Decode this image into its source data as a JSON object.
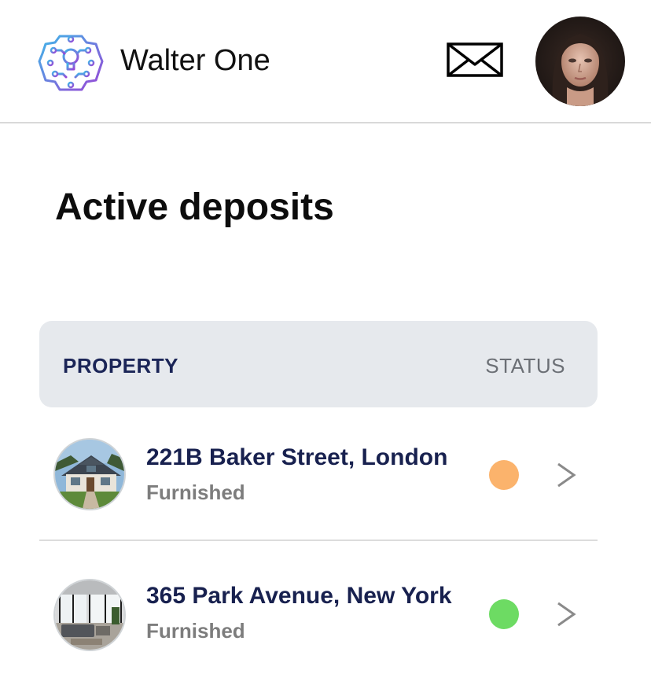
{
  "header": {
    "app_title": "Walter One",
    "logo_icon": "brain-circuit-icon",
    "mail_icon": "envelope-icon",
    "avatar_icon": "user-avatar"
  },
  "main": {
    "page_title": "Active deposits",
    "table": {
      "columns": [
        "PROPERTY",
        "STATUS"
      ],
      "rows": [
        {
          "address": "221B Baker Street, London",
          "type": "Furnished",
          "status_color": "#fbb36c",
          "thumb_icon": "house-photo"
        },
        {
          "address": "365 Park Avenue, New York",
          "type": "Furnished",
          "status_color": "#6ddb63",
          "thumb_icon": "living-room-photo"
        }
      ]
    }
  },
  "colors": {
    "title_navy": "#18214f",
    "header_bg": "#e6e9ed",
    "logo_gradient_start": "#3fb7e8",
    "logo_gradient_end": "#9a46d6"
  }
}
